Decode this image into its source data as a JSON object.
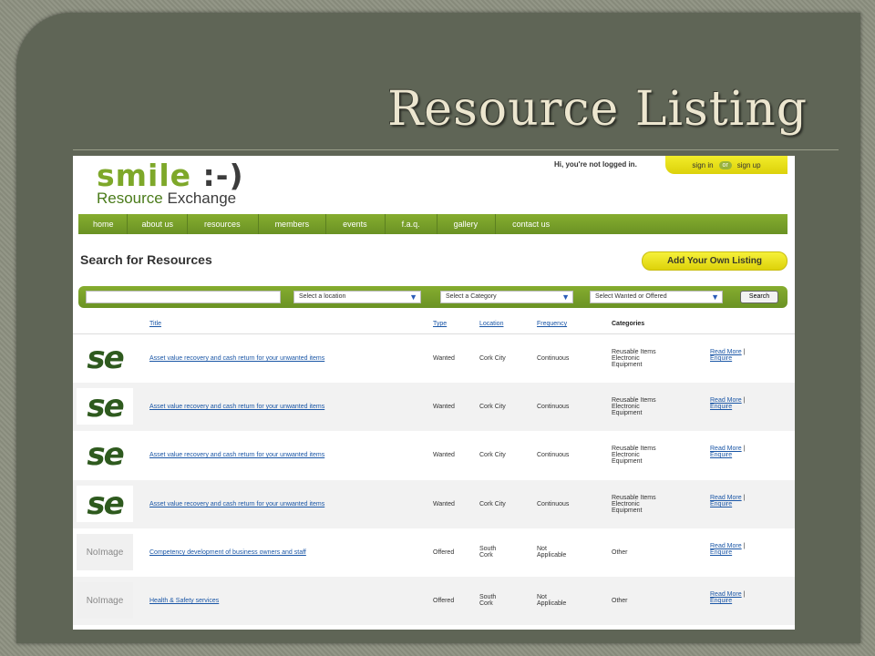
{
  "slide": {
    "title": "Resource Listing"
  },
  "site": {
    "logo_main": "smile",
    "logo_smiley": ":-)",
    "logo_sub_1": "Resource",
    "logo_sub_2": "Exchange",
    "login_msg": "Hi, you're not logged in.",
    "sign_in": "sign in",
    "or": "or",
    "sign_up": "sign up"
  },
  "nav": [
    "home",
    "about us",
    "resources",
    "members",
    "events",
    "f.a.q.",
    "gallery",
    "contact us"
  ],
  "search": {
    "heading": "Search for Resources",
    "add_listing": "Add Your Own Listing",
    "input_value": "",
    "location": "Select a location",
    "category": "Select a Category",
    "wanted": "Select Wanted or Offered",
    "button": "Search"
  },
  "table": {
    "headers": {
      "title": "Title",
      "type": "Type",
      "location": "Location",
      "frequency": "Frequency",
      "categories": "Categories"
    },
    "rows": [
      {
        "thumb": "se",
        "title": "Asset value recovery and cash return for your unwanted items",
        "type": "Wanted",
        "location": [
          "Cork City"
        ],
        "frequency": [
          "Continuous"
        ],
        "categories": [
          "Reusable Items",
          "Electronic",
          "Equipment"
        ],
        "read_more": "Read More",
        "sep": "|",
        "enquire": "Enquire"
      },
      {
        "thumb": "se",
        "title": "Asset value recovery and cash return for your unwanted items",
        "type": "Wanted",
        "location": [
          "Cork City"
        ],
        "frequency": [
          "Continuous"
        ],
        "categories": [
          "Reusable Items",
          "Electronic",
          "Equipment"
        ],
        "read_more": "Read More",
        "sep": "|",
        "enquire": "Enquire"
      },
      {
        "thumb": "se",
        "title": "Asset value recovery and cash return for your unwanted items",
        "type": "Wanted",
        "location": [
          "Cork City"
        ],
        "frequency": [
          "Continuous"
        ],
        "categories": [
          "Reusable Items",
          "Electronic",
          "Equipment"
        ],
        "read_more": "Read More",
        "sep": "|",
        "enquire": "Enquire"
      },
      {
        "thumb": "se",
        "title": "Asset value recovery and cash return for your unwanted items",
        "type": "Wanted",
        "location": [
          "Cork City"
        ],
        "frequency": [
          "Continuous"
        ],
        "categories": [
          "Reusable Items",
          "Electronic",
          "Equipment"
        ],
        "read_more": "Read More",
        "sep": "|",
        "enquire": "Enquire"
      },
      {
        "thumb": "No Image",
        "title": "Competency development of business owners and staff",
        "type": "Offered",
        "location": [
          "South",
          "Cork"
        ],
        "frequency": [
          "Not",
          "Applicable"
        ],
        "categories": [
          "Other"
        ],
        "read_more": "Read More",
        "sep": "|",
        "enquire": "Enquire"
      },
      {
        "thumb": "No Image",
        "title": "Health & Safety services",
        "type": "Offered",
        "location": [
          "South",
          "Cork"
        ],
        "frequency": [
          "Not",
          "Applicable"
        ],
        "categories": [
          "Other"
        ],
        "read_more": "Read More",
        "sep": "|",
        "enquire": "Enquire"
      }
    ]
  },
  "colors": {
    "slide_bg": "#5f6556",
    "nav_green": "#7aa02a",
    "accent_yellow": "#f2ed2a",
    "link_blue": "#1a56a6"
  }
}
